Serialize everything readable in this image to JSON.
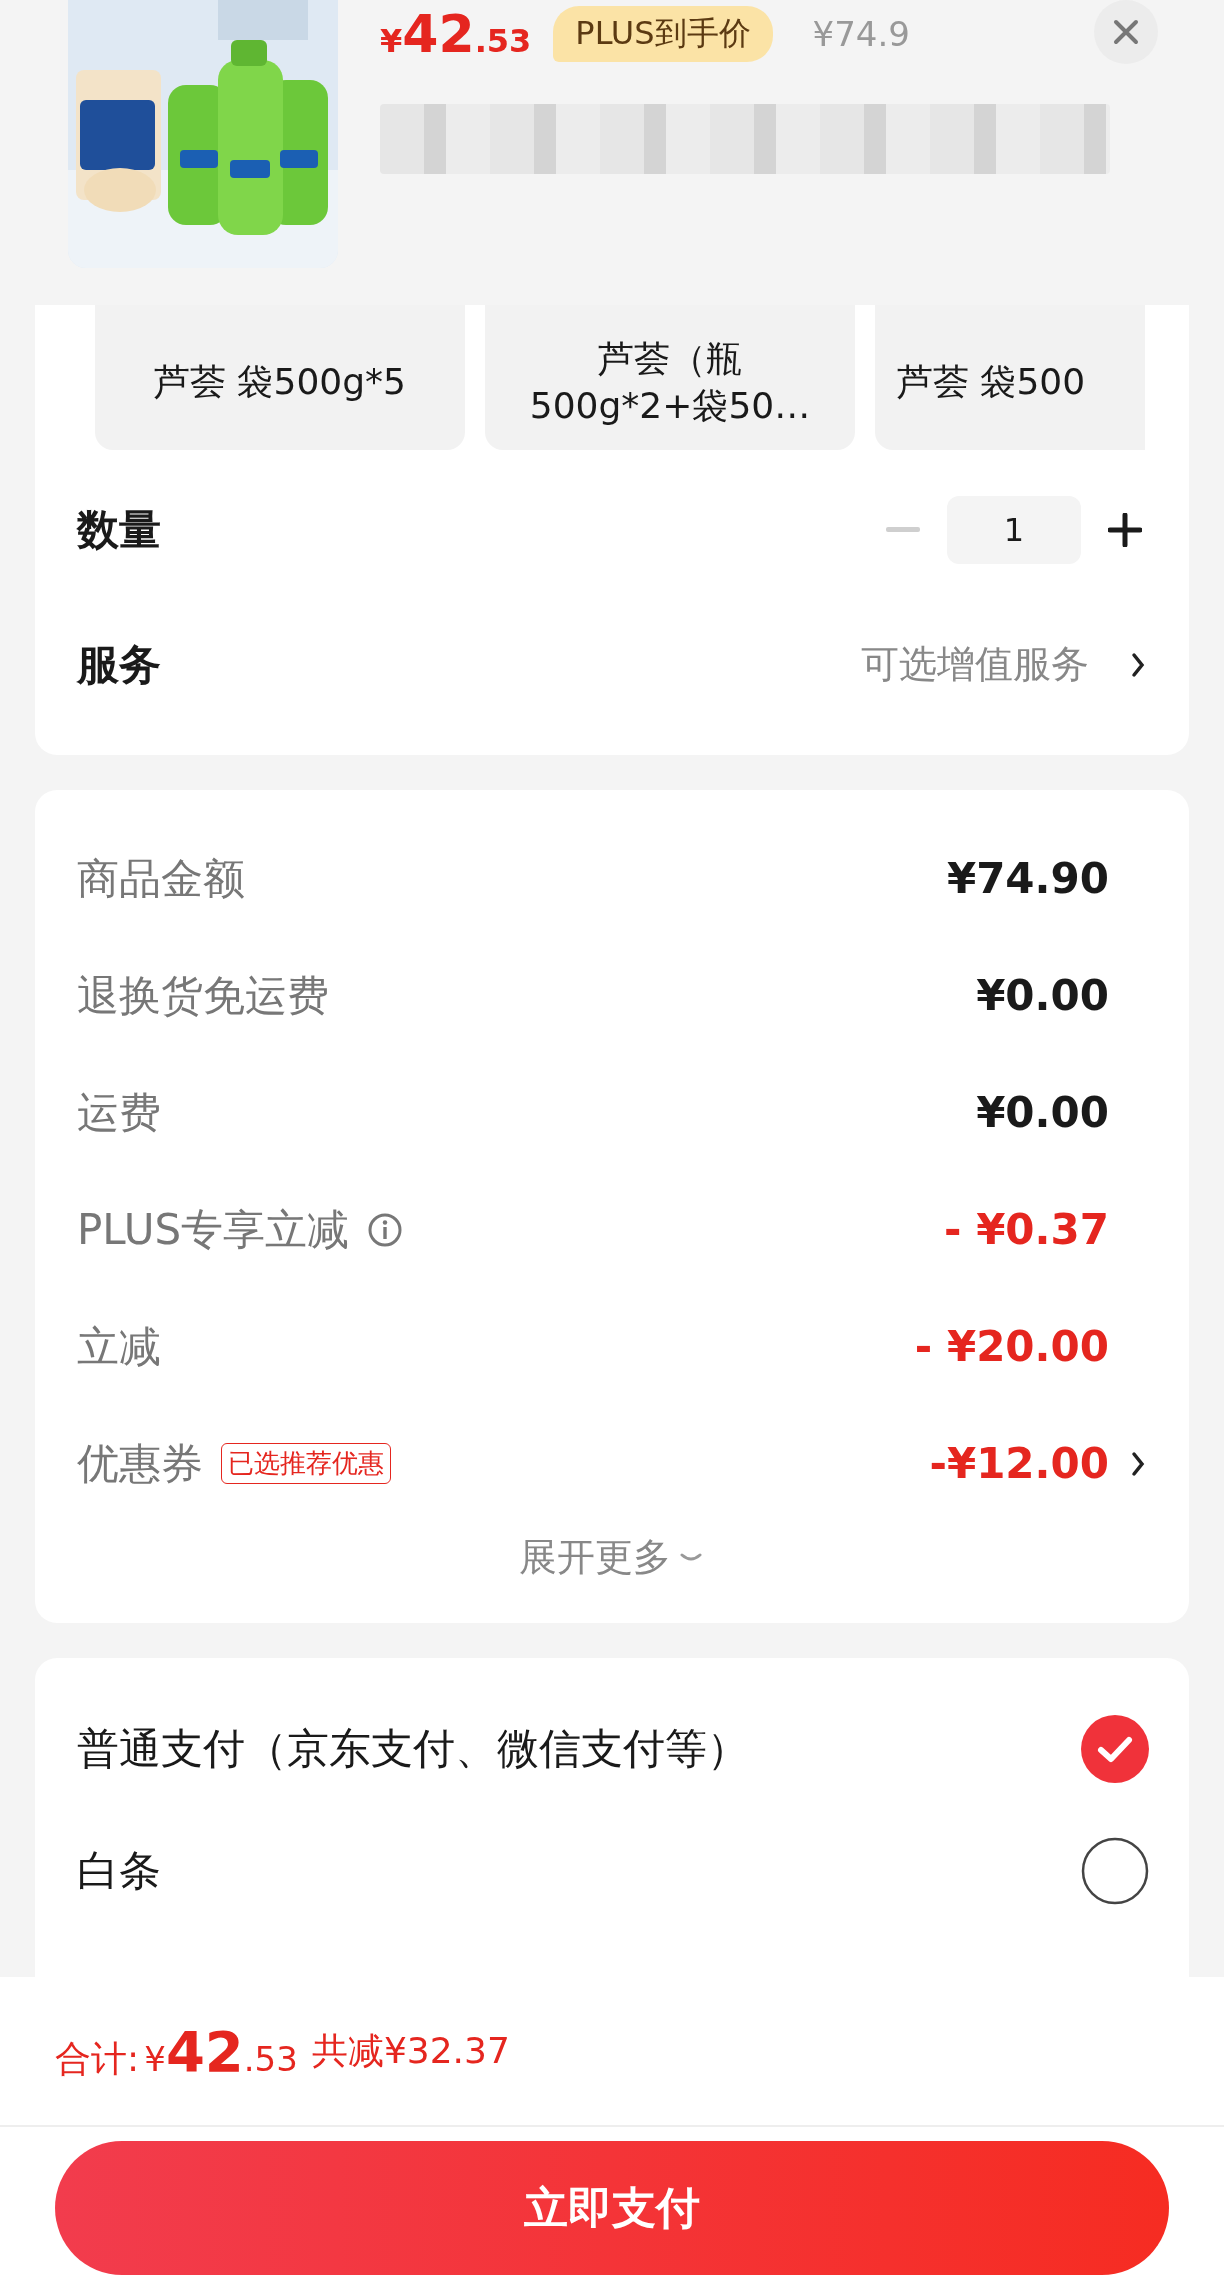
{
  "product": {
    "currency": "¥",
    "price_int": "42",
    "price_dec": ".53",
    "price_badge": "PLUS到手价",
    "original_price": "¥74.9"
  },
  "specs": [
    {
      "label": "芦荟 袋500g*5",
      "selected": false
    },
    {
      "label": "芦荟（瓶\n500g*2+袋50…",
      "selected": false
    },
    {
      "label": "芦荟 袋500",
      "selected": false
    }
  ],
  "quantity": {
    "label": "数量",
    "value": "1",
    "decrease_disabled": true
  },
  "service": {
    "label": "服务",
    "value": "可选增值服务"
  },
  "price_rows": [
    {
      "label": "商品金额",
      "amount": "¥74.90",
      "kind": "plain"
    },
    {
      "label": "退换货免运费",
      "amount": "¥0.00",
      "kind": "plain"
    },
    {
      "label": "运费",
      "amount": "¥0.00",
      "kind": "plain"
    },
    {
      "label": "PLUS专享立减",
      "amount": "- ¥0.37",
      "kind": "discount",
      "info": true
    },
    {
      "label": "立减",
      "amount": "- ¥20.00",
      "kind": "discount"
    },
    {
      "label": "优惠券",
      "tag": "已选推荐优惠",
      "amount": "-¥12.00",
      "kind": "discount",
      "chevron": true
    }
  ],
  "expand": "展开更多",
  "payment": [
    {
      "label": "普通支付（京东支付、微信支付等）",
      "selected": true
    },
    {
      "label": "白条",
      "selected": false
    }
  ],
  "total": {
    "label": "合计:",
    "currency": "¥",
    "int": "42",
    "dec": ".53",
    "saved": "共减¥32.37"
  },
  "pay_button": "立即支付"
}
